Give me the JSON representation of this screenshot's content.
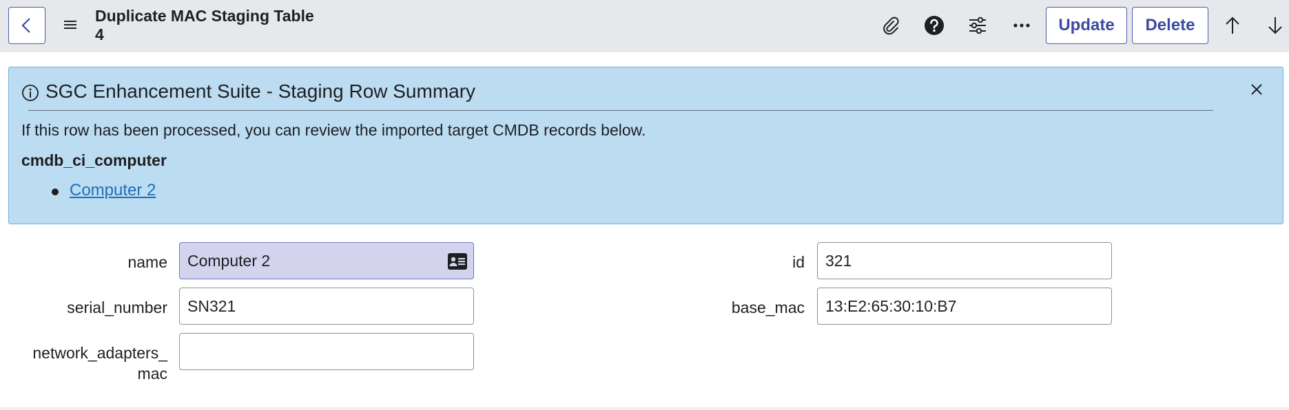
{
  "header": {
    "back_label": "Back",
    "title_line1": "Duplicate MAC Staging Table",
    "title_line2": "4",
    "update_label": "Update",
    "delete_label": "Delete"
  },
  "banner": {
    "title": "SGC Enhancement Suite - Staging Row Summary",
    "text": "If this row has been processed, you can review the imported target CMDB records below.",
    "table_name": "cmdb_ci_computer",
    "records": [
      "Computer 2"
    ]
  },
  "form": {
    "name": {
      "label": "name",
      "value": "Computer 2"
    },
    "serial_number": {
      "label": "serial_number",
      "value": "SN321"
    },
    "network_adapters_mac": {
      "label_line1": "network_adapters_",
      "label_line2": "mac",
      "value": ""
    },
    "id": {
      "label": "id",
      "value": "321"
    },
    "base_mac": {
      "label": "base_mac",
      "value": "13:E2:65:30:10:B7"
    }
  },
  "colors": {
    "header_bg": "#e6e8eb",
    "accent": "#3c4aa0",
    "banner_bg": "#bcdcf1",
    "link": "#1f6fb5",
    "reference_field_bg": "#d3d3ee"
  },
  "icons": [
    "chevron-left-icon",
    "hamburger-menu-icon",
    "paperclip-icon",
    "help-icon",
    "sliders-icon",
    "more-icon",
    "arrow-up-icon",
    "arrow-down-icon",
    "info-icon",
    "close-icon",
    "contact-card-icon"
  ]
}
